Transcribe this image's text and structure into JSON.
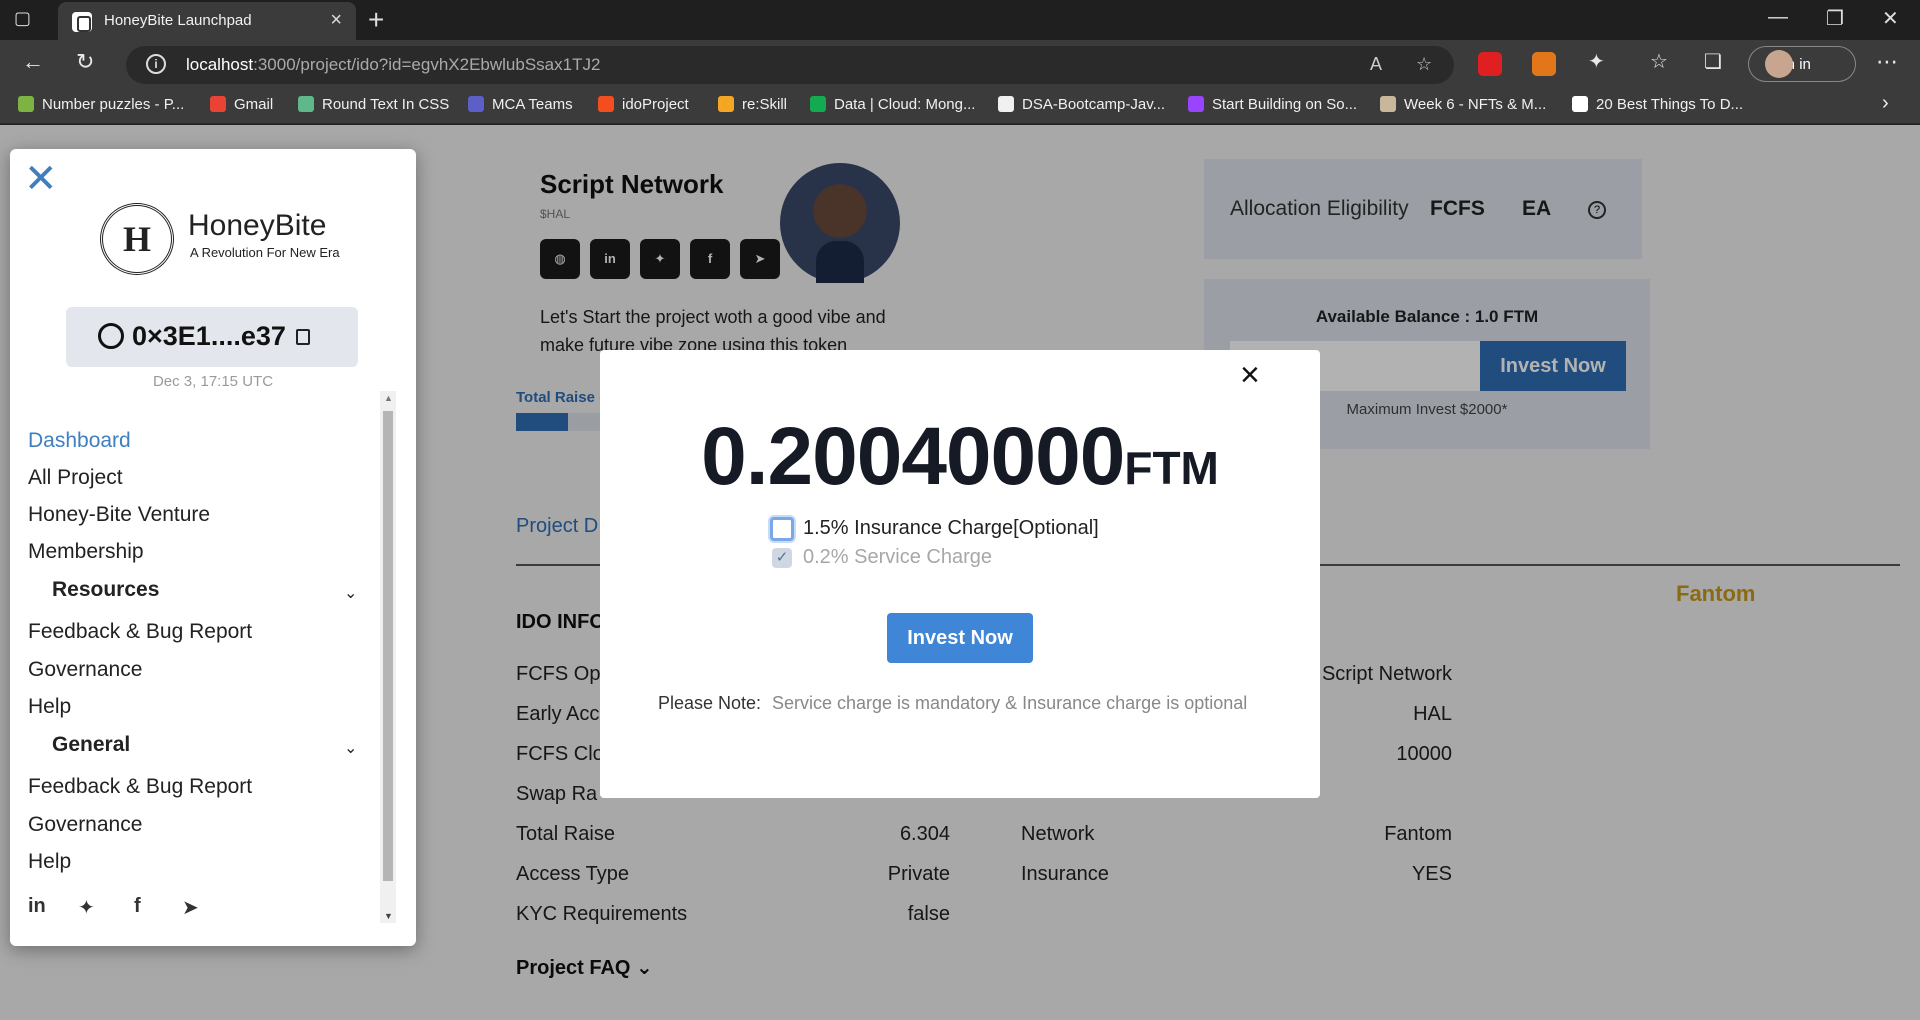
{
  "browser": {
    "tab_title": "HoneyBite Launchpad",
    "url_host": "localhost",
    "url_path": ":3000/project/ido?id=egvhX2EbwlubSsax1TJ2",
    "signin_label": "Sign in",
    "bookmarks": [
      "Number puzzles - P...",
      "Gmail",
      "Round Text In CSS",
      "MCA Teams",
      "idoProject",
      "re:Skill",
      "Data | Cloud: Mong...",
      "DSA-Bootcamp-Jav...",
      "Start Building on So...",
      "Week 6 - NFTs & M...",
      "20 Best Things To D..."
    ]
  },
  "sidebar": {
    "brand_name": "HoneyBite",
    "brand_tagline": "A Revolution For New Era",
    "logo_letter": "H",
    "wallet_address": "0×3E1....e37",
    "timestamp": "Dec 3, 17:15 UTC",
    "menu": {
      "dashboard": "Dashboard",
      "all_project": "All Project",
      "venture": "Honey-Bite Venture",
      "membership": "Membership",
      "resources": "Resources",
      "feedback1": "Feedback & Bug Report",
      "governance1": "Governance",
      "help1": "Help",
      "general": "General",
      "feedback2": "Feedback & Bug Report",
      "governance2": "Governance",
      "help2": "Help"
    }
  },
  "project": {
    "name": "Script Network",
    "symbol": "$HAL",
    "description": "Let's Start the project woth a good vibe and make future vibe zone using this token",
    "total_raise_label": "Total Raise (",
    "raise_fraction": 0.29,
    "allocation_label": "Allocation Eligibility",
    "alloc_fcfs": "FCFS",
    "alloc_ea": "EA",
    "available_balance": "Available Balance : 1.0 FTM",
    "invest_button": "Invest Now",
    "max_invest": "Maximum Invest $2000*",
    "details_tab": "Project D",
    "network_badge": "Fantom",
    "ido_info_title": "IDO INFO",
    "left_rows": [
      {
        "label": "FCFS Op",
        "value": ""
      },
      {
        "label": "Early Acc",
        "value": ""
      },
      {
        "label": "FCFS Clo",
        "value": ""
      },
      {
        "label": "Swap Ra",
        "value": ""
      },
      {
        "label": "Total Raise",
        "value": "6.304"
      },
      {
        "label": "Access Type",
        "value": "Private"
      },
      {
        "label": "KYC Requirements",
        "value": "false"
      }
    ],
    "right_rows": [
      {
        "label": "",
        "value": "Script Network"
      },
      {
        "label": "",
        "value": "HAL"
      },
      {
        "label": "",
        "value": "10000"
      },
      {
        "label": "",
        "value": ""
      },
      {
        "label": "Network",
        "value": "Fantom"
      },
      {
        "label": "Insurance",
        "value": "YES"
      }
    ],
    "faq_title": "Project FAQ"
  },
  "modal": {
    "amount": "0.20040000",
    "unit": "FTM",
    "insurance_label": "1.5% Insurance Charge[Optional]",
    "insurance_checked": false,
    "service_label": "0.2% Service Charge",
    "service_checked": true,
    "invest_button": "Invest Now",
    "note_label": "Please Note:",
    "note_text": "Service charge is mandatory & Insurance charge is optional"
  }
}
